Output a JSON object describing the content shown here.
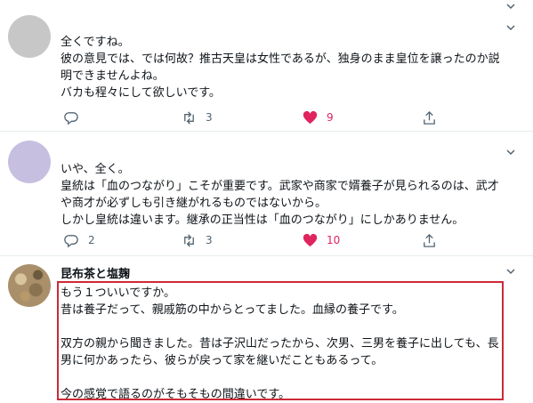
{
  "tweets": [
    {
      "text": "全くですね。\n彼の意見では、では何故？推古天皇は女性であるが、独身のまま皇位を譲ったのか説明できませんよね。\nバカも程々にして欲しいです。",
      "replies": "",
      "retweets": "3",
      "likes": "9",
      "liked": true
    },
    {
      "text": "いや、全く。\n皇統は「血のつながり」こそが重要です。武家や商家で婿養子が見られるのは、武才や商才が必ずしも引き継がれるものではないから。\nしかし皇統は違います。継承の正当性は「血のつながり」にしかありません。",
      "replies": "2",
      "retweets": "3",
      "likes": "10",
      "liked": true
    },
    {
      "user_name": "昆布茶と塩麹",
      "text": "もう１ついいですか。\n昔は養子だって、親戚筋の中からとってました。血縁の養子です。\n\n双方の親から聞きました。昔は子沢山だったから、次男、三男を養子に出しても、長男に何かあったら、彼らが戻って家を継いだこともあるって。\n\n今の感覚で語るのがそもそもの間違いです。"
    }
  ],
  "icons": {
    "reply": "reply-icon",
    "retweet": "retweet-icon",
    "like": "heart-icon",
    "share": "share-icon",
    "more": "chevron-down-icon"
  },
  "colors": {
    "like_active": "#e0245e",
    "highlight_border": "#cc2a36",
    "action_gray": "#536471"
  }
}
